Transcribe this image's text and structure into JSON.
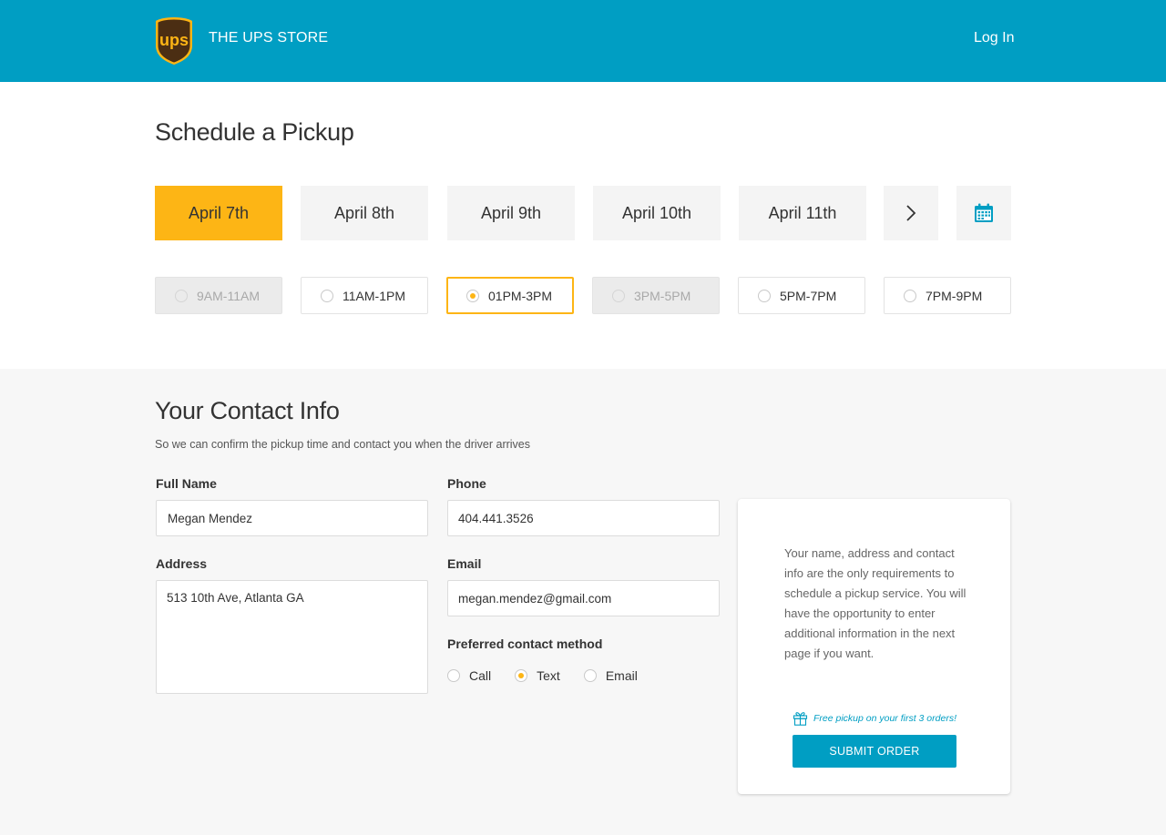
{
  "header": {
    "brand": "THE UPS STORE",
    "logo_text": "ups",
    "login_label": "Log In",
    "color": "#009ec3"
  },
  "schedule": {
    "title": "Schedule a Pickup",
    "dates": [
      {
        "label": "April 7th",
        "active": true
      },
      {
        "label": "April 8th",
        "active": false
      },
      {
        "label": "April 9th",
        "active": false
      },
      {
        "label": "April 10th",
        "active": false
      },
      {
        "label": "April 11th",
        "active": false
      }
    ],
    "next_icon": "chevron-right-icon",
    "calendar_icon": "calendar-icon",
    "times": [
      {
        "label": "9AM-11AM",
        "state": "disabled"
      },
      {
        "label": "11AM-1PM",
        "state": "available"
      },
      {
        "label": "01PM-3PM",
        "state": "selected"
      },
      {
        "label": "3PM-5PM",
        "state": "disabled"
      },
      {
        "label": "5PM-7PM",
        "state": "available"
      },
      {
        "label": "7PM-9PM",
        "state": "available"
      }
    ],
    "accent_color": "#fdb515"
  },
  "contact": {
    "title": "Your Contact Info",
    "subtitle": "So we can confirm the pickup time and contact you when the driver arrives",
    "full_name": {
      "label": "Full Name",
      "value": "Megan Mendez"
    },
    "phone": {
      "label": "Phone",
      "value": "404.441.3526"
    },
    "address": {
      "label": "Address",
      "value": "513 10th Ave, Atlanta GA"
    },
    "email": {
      "label": "Email",
      "value": "megan.mendez@gmail.com"
    },
    "preferred": {
      "label": "Preferred contact method",
      "options": [
        {
          "label": "Call",
          "checked": false
        },
        {
          "label": "Text",
          "checked": true
        },
        {
          "label": "Email",
          "checked": false
        }
      ]
    }
  },
  "card": {
    "text": "Your name, address and contact info are the only requirements to schedule a pickup service. You will have the opportunity to enter additional information in the next page if you want.",
    "promo": "Free pickup on your first 3 orders!",
    "promo_icon": "gift-icon",
    "submit_label": "SUBMIT ORDER"
  }
}
